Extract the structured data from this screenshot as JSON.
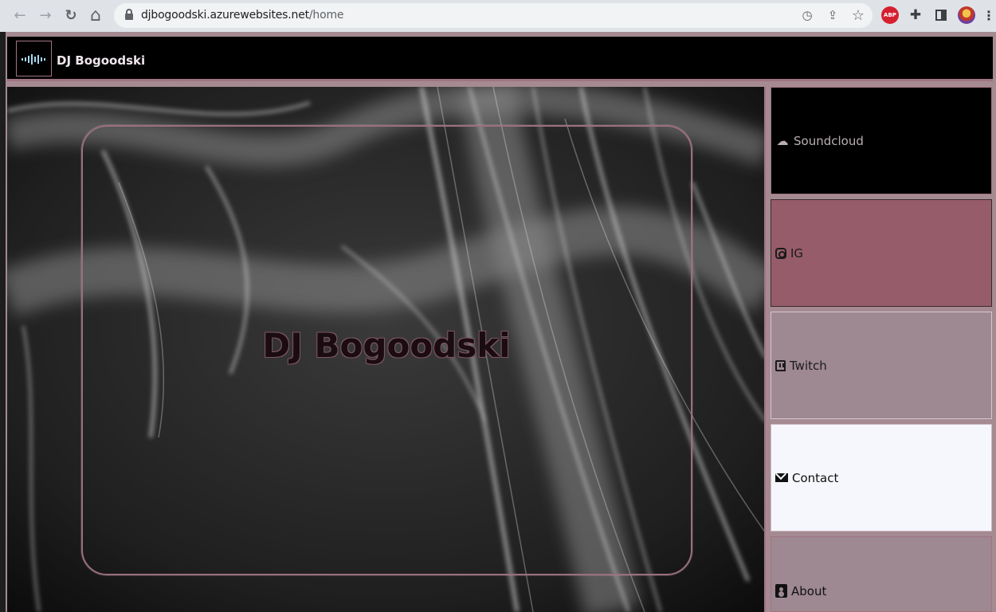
{
  "browser": {
    "url_host": "djbogoodski.azurewebsites.net",
    "url_path": "/home",
    "back_icon": "←",
    "forward_icon": "→",
    "reload_icon": "↻",
    "home_icon": "⌂",
    "star_icon": "☆",
    "share_icon": "⇪",
    "speed_icon": "◷",
    "extension_abp_label": "ABP",
    "menu_icon": "⋮",
    "puzzle_icon": "✚"
  },
  "site": {
    "brand_name": "DJ Bogoodski",
    "hero_title": "DJ Bogoodski",
    "accent_color": "#a07482"
  },
  "sidebar": {
    "items": [
      {
        "label": "Soundcloud",
        "icon": "cloud-icon",
        "glyph": "☁"
      },
      {
        "label": "IG",
        "icon": "instagram-icon"
      },
      {
        "label": "Twitch",
        "icon": "twitch-icon"
      },
      {
        "label": "Contact",
        "icon": "envelope-icon"
      },
      {
        "label": "About",
        "icon": "id-badge-icon"
      }
    ]
  }
}
